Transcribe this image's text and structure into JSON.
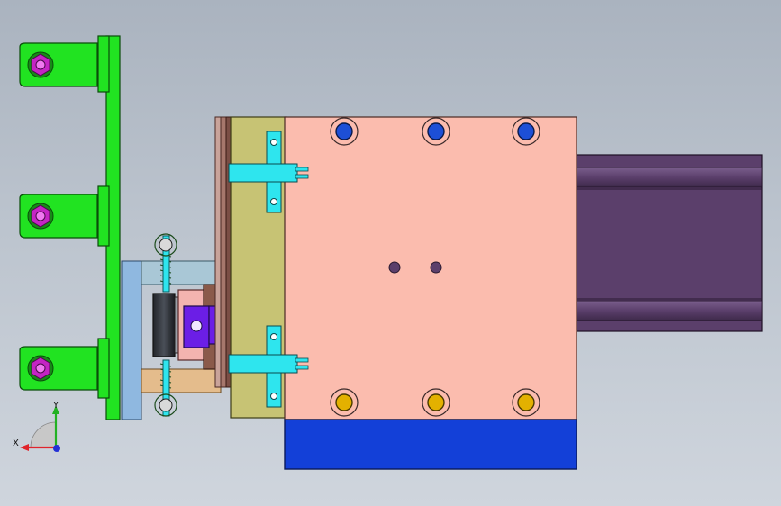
{
  "view": {
    "colors": {
      "background_top": "#aab3bf",
      "background_bottom": "#cfd5dd",
      "green_bracket": "#21e321",
      "pink_plate": "#fbbcae",
      "blue_base": "#1340d8",
      "purple_motor": "#5b3f6b",
      "olive_plate": "#c7c374",
      "cyan_clip": "#2ee5ee",
      "bolt_blue": "#1d4fd6",
      "bolt_yellow": "#e3b100",
      "sensor_magenta": "#c424c4",
      "cylinder_violet": "#6b1ee6"
    }
  },
  "triad": {
    "x_label": "X",
    "y_label": "Y",
    "x_color": "#e0242b",
    "y_color": "#23b123",
    "z_color": "#2431d6"
  }
}
